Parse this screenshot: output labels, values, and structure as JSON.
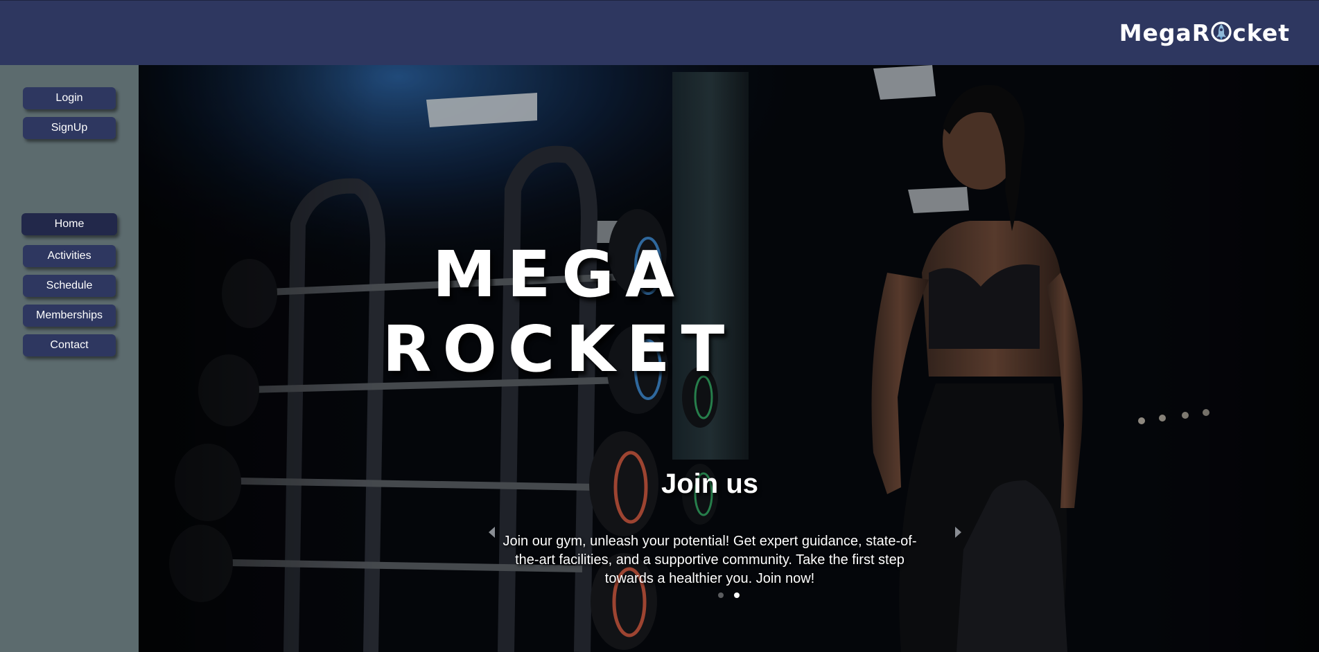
{
  "header": {
    "logo_part1": "MegaR",
    "logo_part2": "cket"
  },
  "sidebar": {
    "auth": [
      {
        "label": "Login"
      },
      {
        "label": "SignUp"
      }
    ],
    "nav": [
      {
        "label": "Home",
        "active": true
      },
      {
        "label": "Activities"
      },
      {
        "label": "Schedule"
      },
      {
        "label": "Memberships"
      },
      {
        "label": "Contact"
      }
    ]
  },
  "hero": {
    "title_line1": "MEGA",
    "title_line2": "ROCKET",
    "caption_title": "Join us",
    "caption_text": "Join our gym, unleash your potential! Get expert guidance, state-of-the-art facilities, and a supportive community. Take the first step towards a healthier you. Join now!",
    "slides_total": 2,
    "active_slide": 2
  },
  "colors": {
    "header_bg": "#2e3760",
    "sidebar_bg": "#5c6b6e",
    "button_bg": "#2e3760",
    "button_active_bg": "#22284a"
  },
  "icons": {
    "logo_o": "rocket-icon",
    "prev": "chevron-left-icon",
    "next": "chevron-right-icon"
  }
}
